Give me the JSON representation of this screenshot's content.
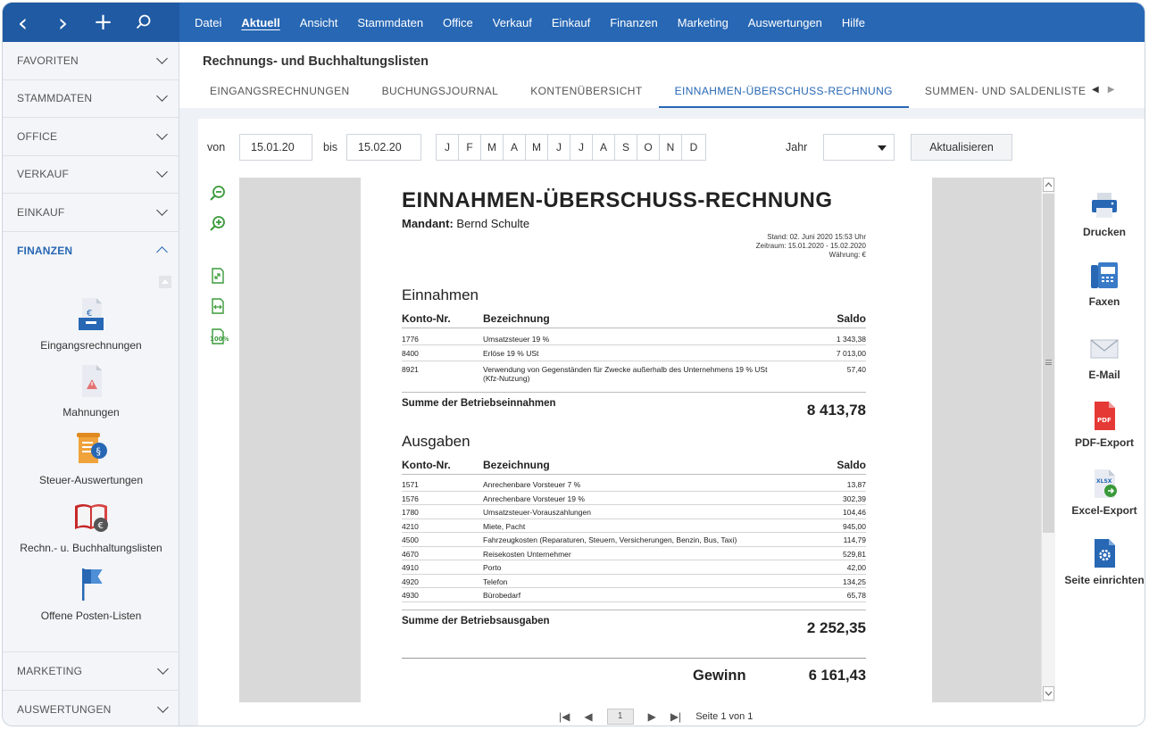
{
  "nav": {
    "back": "‹",
    "forward": "›",
    "add": "+",
    "search": "⌕"
  },
  "menu": [
    "Datei",
    "Aktuell",
    "Ansicht",
    "Stammdaten",
    "Office",
    "Verkauf",
    "Einkauf",
    "Finanzen",
    "Marketing",
    "Auswertungen",
    "Hilfe"
  ],
  "sidebar": {
    "sections_top": [
      "FAVORITEN",
      "STAMMDATEN",
      "OFFICE",
      "VERKAUF",
      "EINKAUF"
    ],
    "open_section": "FINANZEN",
    "items": [
      "Eingangsrechnungen",
      "Mahnungen",
      "Steuer-Auswertungen",
      "Rechn.- u. Buchhaltungslisten",
      "Offene Posten-Listen"
    ],
    "sections_bottom": [
      "MARKETING",
      "AUSWERTUNGEN"
    ]
  },
  "header": {
    "title": "Rechnungs- und Buchhaltungslisten"
  },
  "tabs": [
    "EINGANGSRECHNUNGEN",
    "BUCHUNGSJOURNAL",
    "KONTENÜBERSICHT",
    "EINNAHMEN-ÜBERSCHUSS-RECHNUNG",
    "SUMMEN- UND SALDENLISTE"
  ],
  "filter": {
    "von_label": "von",
    "von_value": "15.01.20",
    "bis_label": "bis",
    "bis_value": "15.02.20",
    "months": [
      "J",
      "F",
      "M",
      "A",
      "M",
      "J",
      "J",
      "A",
      "S",
      "O",
      "N",
      "D"
    ],
    "jahr_label": "Jahr",
    "jahr_value": "",
    "refresh_label": "Aktualisieren"
  },
  "tools": {
    "zoom_out": "zoom-out-icon",
    "zoom_in": "zoom-in-icon",
    "fit_page": "fit-page-icon",
    "fit_width": "fit-width-icon",
    "zoom_100": "100%"
  },
  "report": {
    "title": "EINNAHMEN-ÜBERSCHUSS-RECHNUNG",
    "mandant_label": "Mandant:",
    "mandant_name": "Bernd Schulte",
    "stand": "Stand: 02. Juni 2020 15:53 Uhr",
    "zeitraum": "Zeitraum: 15.01.2020 - 15.02.2020",
    "waehrung": "Währung: €",
    "columns": {
      "konto": "Konto-Nr.",
      "bez": "Bezeichnung",
      "saldo": "Saldo"
    },
    "einnahmen": {
      "heading": "Einnahmen",
      "rows": [
        {
          "konto": "1776",
          "bez": "Umsatzsteuer 19 %",
          "saldo": "1 343,38"
        },
        {
          "konto": "8400",
          "bez": "Erlöse 19 % USt",
          "saldo": "7 013,00"
        },
        {
          "konto": "8921",
          "bez": "Verwendung von Gegenständen für Zwecke außerhalb des Unternehmens 19 % USt",
          "bez2": "(Kfz-Nutzung)",
          "saldo": "57,40"
        }
      ],
      "sum_label": "Summe der Betriebseinnahmen",
      "sum_value": "8 413,78"
    },
    "ausgaben": {
      "heading": "Ausgaben",
      "rows": [
        {
          "konto": "1571",
          "bez": "Anrechenbare Vorsteuer 7 %",
          "saldo": "13,87"
        },
        {
          "konto": "1576",
          "bez": "Anrechenbare Vorsteuer 19 %",
          "saldo": "302,39"
        },
        {
          "konto": "1780",
          "bez": "Umsatzsteuer-Vorauszahlungen",
          "saldo": "104,46"
        },
        {
          "konto": "4210",
          "bez": "Miete, Pacht",
          "saldo": "945,00"
        },
        {
          "konto": "4500",
          "bez": "Fahrzeugkosten (Reparaturen, Steuern, Versicherungen, Benzin, Bus, Taxi)",
          "saldo": "114,79"
        },
        {
          "konto": "4670",
          "bez": "Reisekosten Unternehmer",
          "saldo": "529,81"
        },
        {
          "konto": "4910",
          "bez": "Porto",
          "saldo": "42,00"
        },
        {
          "konto": "4920",
          "bez": "Telefon",
          "saldo": "134,25"
        },
        {
          "konto": "4930",
          "bez": "Bürobedarf",
          "saldo": "65,78"
        }
      ],
      "sum_label": "Summe der Betriebsausgaben",
      "sum_value": "2 252,35"
    },
    "gewinn_label": "Gewinn",
    "gewinn_value": "6 161,43"
  },
  "pager": {
    "page": "1",
    "label": "Seite 1 von 1"
  },
  "actions": [
    "Drucken",
    "Faxen",
    "E-Mail",
    "PDF-Export",
    "Excel-Export",
    "Seite einrichten"
  ],
  "icon_labels": {
    "pdf": "PDF",
    "xlsx": "XLSX",
    "euro": "€"
  },
  "colors": {
    "primary": "#2767b4",
    "accent_green": "#3a9a3a",
    "pdf_red": "#e53935"
  }
}
